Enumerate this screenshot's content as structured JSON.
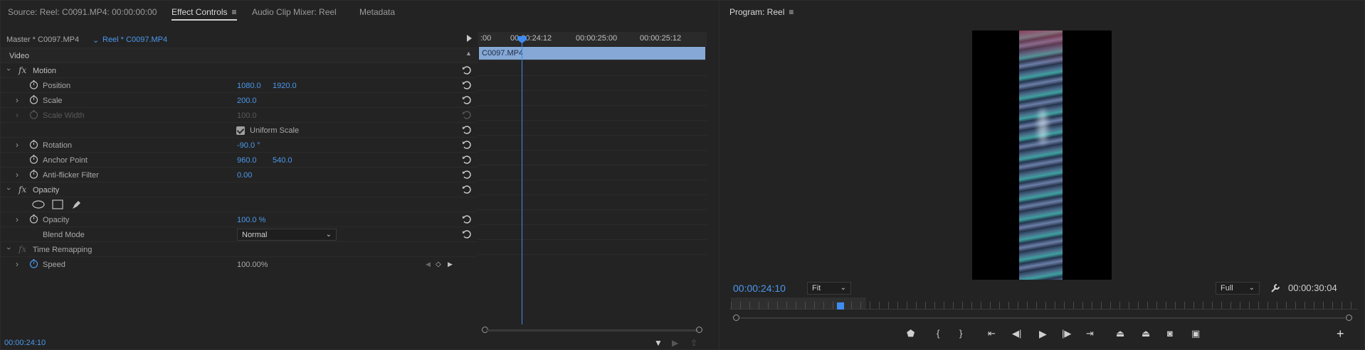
{
  "source_panel": {
    "tabs": [
      {
        "label": "Source: Reel: C0091.MP4: 00:00:00:00",
        "active": false
      },
      {
        "label": "Effect Controls",
        "active": true
      },
      {
        "label": "Audio Clip Mixer: Reel",
        "active": false
      },
      {
        "label": "Metadata",
        "active": false
      }
    ],
    "menu_icon": "hamburger-icon"
  },
  "effect_controls": {
    "master_clip": "Master * C0097.MP4",
    "sequence_clip": "Reel * C0097.MP4",
    "video_label": "Video",
    "motion_label": "Motion",
    "position": {
      "label": "Position",
      "x": "1080.0",
      "y": "1920.0"
    },
    "scale": {
      "label": "Scale",
      "value": "200.0"
    },
    "scale_width": {
      "label": "Scale Width",
      "value": "100.0"
    },
    "uniform_scale": {
      "label": "Uniform Scale",
      "checked": true
    },
    "rotation": {
      "label": "Rotation",
      "value": "-90.0 °"
    },
    "anchor_point": {
      "label": "Anchor Point",
      "x": "960.0",
      "y": "540.0"
    },
    "anti_flicker": {
      "label": "Anti-flicker Filter",
      "value": "0.00"
    },
    "opacity_label": "Opacity",
    "opacity": {
      "label": "Opacity",
      "value": "100.0 %"
    },
    "blend_mode": {
      "label": "Blend Mode",
      "value": "Normal"
    },
    "time_remapping_label": "Time Remapping",
    "speed": {
      "label": "Speed",
      "value": "100.00%"
    },
    "fx_label": "fx"
  },
  "timeline": {
    "ruler_labels": [
      ":00",
      "00:00:24:12",
      "00:00:25:00",
      "00:00:25:12"
    ],
    "clip_name": "C0097.MP4",
    "current_time": "00:00:24:10"
  },
  "program_monitor": {
    "title": "Program: Reel",
    "current_time": "00:00:24:10",
    "zoom": "Fit",
    "resolution": "Full",
    "duration": "00:00:30:04"
  },
  "colors": {
    "accent_blue": "#4c98ec",
    "clip_blue": "#86a8d6",
    "panel_bg": "#232323"
  }
}
